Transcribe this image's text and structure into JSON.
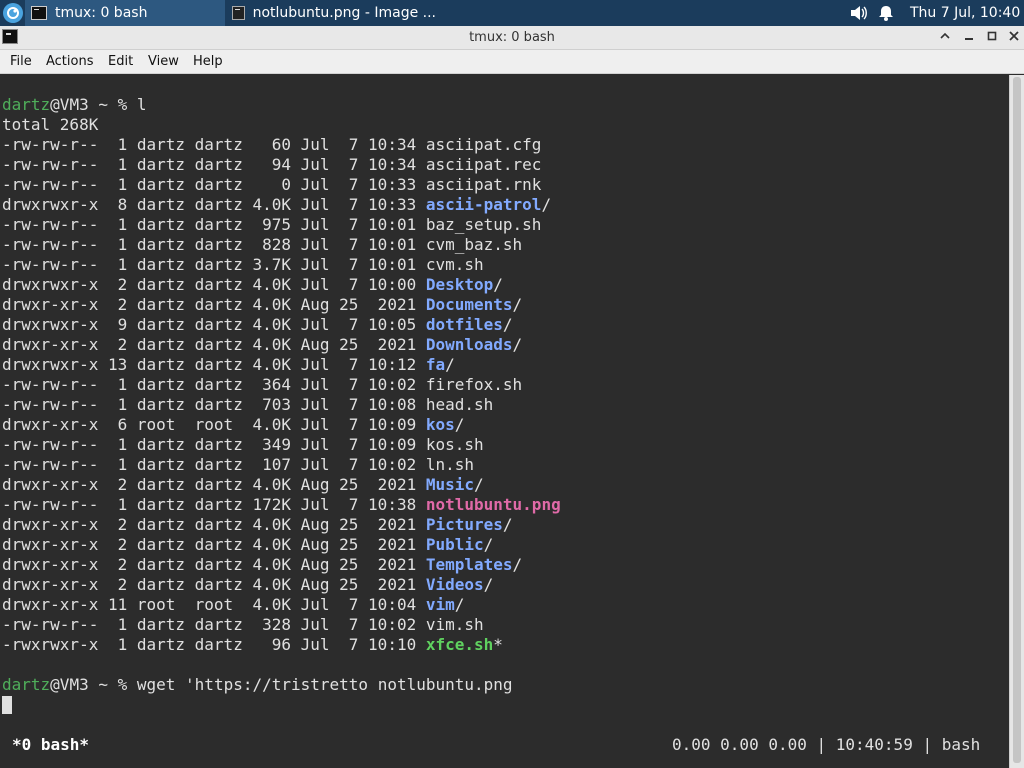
{
  "panel": {
    "tasks": [
      {
        "label": "tmux: 0 bash"
      },
      {
        "label": "notlubuntu.png - Image ..."
      }
    ],
    "clock": "Thu  7 Jul, 10:40"
  },
  "window": {
    "title": "tmux: 0 bash"
  },
  "menubar": {
    "items": [
      "File",
      "Actions",
      "Edit",
      "View",
      "Help"
    ]
  },
  "terminal": {
    "prompt_user": "dartz",
    "prompt_rest": "@VM3 ~ % ",
    "command1": "l",
    "total": "total 268K",
    "listing": [
      {
        "meta": "-rw-rw-r--  1 dartz dartz   60 Jul  7 10:34 ",
        "name": "asciipat.cfg",
        "kind": "file",
        "suffix": ""
      },
      {
        "meta": "-rw-rw-r--  1 dartz dartz   94 Jul  7 10:34 ",
        "name": "asciipat.rec",
        "kind": "file",
        "suffix": ""
      },
      {
        "meta": "-rw-rw-r--  1 dartz dartz    0 Jul  7 10:33 ",
        "name": "asciipat.rnk",
        "kind": "file",
        "suffix": ""
      },
      {
        "meta": "drwxrwxr-x  8 dartz dartz 4.0K Jul  7 10:33 ",
        "name": "ascii-patrol",
        "kind": "dir",
        "suffix": "/"
      },
      {
        "meta": "-rw-rw-r--  1 dartz dartz  975 Jul  7 10:01 ",
        "name": "baz_setup.sh",
        "kind": "file",
        "suffix": ""
      },
      {
        "meta": "-rw-rw-r--  1 dartz dartz  828 Jul  7 10:01 ",
        "name": "cvm_baz.sh",
        "kind": "file",
        "suffix": ""
      },
      {
        "meta": "-rw-rw-r--  1 dartz dartz 3.7K Jul  7 10:01 ",
        "name": "cvm.sh",
        "kind": "file",
        "suffix": ""
      },
      {
        "meta": "drwxrwxr-x  2 dartz dartz 4.0K Jul  7 10:00 ",
        "name": "Desktop",
        "kind": "dir",
        "suffix": "/"
      },
      {
        "meta": "drwxr-xr-x  2 dartz dartz 4.0K Aug 25  2021 ",
        "name": "Documents",
        "kind": "dir",
        "suffix": "/"
      },
      {
        "meta": "drwxrwxr-x  9 dartz dartz 4.0K Jul  7 10:05 ",
        "name": "dotfiles",
        "kind": "dir",
        "suffix": "/"
      },
      {
        "meta": "drwxr-xr-x  2 dartz dartz 4.0K Aug 25  2021 ",
        "name": "Downloads",
        "kind": "dir",
        "suffix": "/"
      },
      {
        "meta": "drwxrwxr-x 13 dartz dartz 4.0K Jul  7 10:12 ",
        "name": "fa",
        "kind": "dir",
        "suffix": "/"
      },
      {
        "meta": "-rw-rw-r--  1 dartz dartz  364 Jul  7 10:02 ",
        "name": "firefox.sh",
        "kind": "file",
        "suffix": ""
      },
      {
        "meta": "-rw-rw-r--  1 dartz dartz  703 Jul  7 10:08 ",
        "name": "head.sh",
        "kind": "file",
        "suffix": ""
      },
      {
        "meta": "drwxr-xr-x  6 root  root  4.0K Jul  7 10:09 ",
        "name": "kos",
        "kind": "dir",
        "suffix": "/"
      },
      {
        "meta": "-rw-rw-r--  1 dartz dartz  349 Jul  7 10:09 ",
        "name": "kos.sh",
        "kind": "file",
        "suffix": ""
      },
      {
        "meta": "-rw-rw-r--  1 dartz dartz  107 Jul  7 10:02 ",
        "name": "ln.sh",
        "kind": "file",
        "suffix": ""
      },
      {
        "meta": "drwxr-xr-x  2 dartz dartz 4.0K Aug 25  2021 ",
        "name": "Music",
        "kind": "dir",
        "suffix": "/"
      },
      {
        "meta": "-rw-rw-r--  1 dartz dartz 172K Jul  7 10:38 ",
        "name": "notlubuntu.png",
        "kind": "img",
        "suffix": ""
      },
      {
        "meta": "drwxr-xr-x  2 dartz dartz 4.0K Aug 25  2021 ",
        "name": "Pictures",
        "kind": "dir",
        "suffix": "/"
      },
      {
        "meta": "drwxr-xr-x  2 dartz dartz 4.0K Aug 25  2021 ",
        "name": "Public",
        "kind": "dir",
        "suffix": "/"
      },
      {
        "meta": "drwxr-xr-x  2 dartz dartz 4.0K Aug 25  2021 ",
        "name": "Templates",
        "kind": "dir",
        "suffix": "/"
      },
      {
        "meta": "drwxr-xr-x  2 dartz dartz 4.0K Aug 25  2021 ",
        "name": "Videos",
        "kind": "dir",
        "suffix": "/"
      },
      {
        "meta": "drwxr-xr-x 11 root  root  4.0K Jul  7 10:04 ",
        "name": "vim",
        "kind": "dir",
        "suffix": "/"
      },
      {
        "meta": "-rw-rw-r--  1 dartz dartz  328 Jul  7 10:02 ",
        "name": "vim.sh",
        "kind": "file",
        "suffix": ""
      },
      {
        "meta": "-rwxrwxr-x  1 dartz dartz   96 Jul  7 10:10 ",
        "name": "xfce.sh",
        "kind": "exec",
        "suffix": "*"
      }
    ],
    "command2": "wget 'https://tristretto notlubuntu.png"
  },
  "tmux_status": {
    "left": "*0 bash*",
    "right": "0.00 0.00 0.00 | 10:40:59 | bash"
  },
  "colors": {
    "panel_bg": "#1b3c5c",
    "terminal_bg": "#2c2c2c",
    "prompt_user": "#4fae5a",
    "directory": "#82aaff",
    "image_file": "#e06aa8",
    "executable": "#5fd15f"
  },
  "icons": {
    "launcher": "lubuntu-logo-icon",
    "volume": "volume-icon",
    "notifications": "bell-icon"
  }
}
